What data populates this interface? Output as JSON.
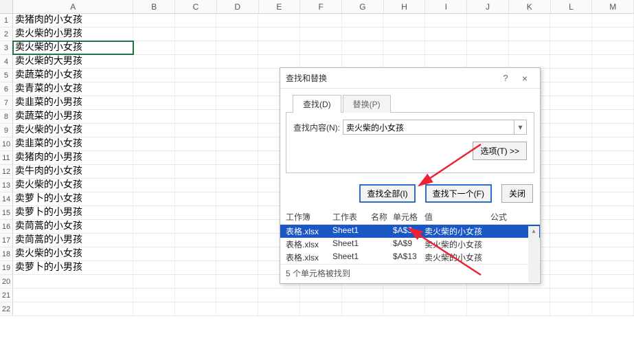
{
  "columns": [
    "A",
    "B",
    "C",
    "D",
    "E",
    "F",
    "G",
    "H",
    "I",
    "J",
    "K",
    "L",
    "M"
  ],
  "rows": [
    "卖猪肉的小女孩",
    "卖火柴的小男孩",
    "卖火柴的小女孩",
    "卖火柴的大男孩",
    "卖蔬菜的小女孩",
    "卖青菜的小女孩",
    "卖韭菜的小男孩",
    "卖蔬菜的小男孩",
    "卖火柴的小女孩",
    "卖韭菜的小女孩",
    "卖猪肉的小男孩",
    "卖牛肉的小女孩",
    "卖火柴的小女孩",
    "卖萝卜的小女孩",
    "卖萝卜的小男孩",
    "卖茼蒿的小女孩",
    "卖茼蒿的小男孩",
    "卖火柴的小女孩",
    "卖萝卜的小男孩",
    "",
    "",
    ""
  ],
  "selected_row_index": 2,
  "dialog": {
    "title": "查找和替换",
    "help": "?",
    "close": "×",
    "tab_find": "查找(D)",
    "tab_replace": "替换(P)",
    "label_content": "查找内容(N):",
    "input_value": "卖火柴的小女孩",
    "options_btn": "选项(T) >>",
    "find_all": "查找全部(I)",
    "find_next": "查找下一个(F)",
    "close_btn": "关闭",
    "heads": {
      "workbook": "工作簿",
      "sheet": "工作表",
      "name": "名称",
      "cell": "单元格",
      "value": "值",
      "formula": "公式"
    },
    "results": [
      {
        "workbook": "表格.xlsx",
        "sheet": "Sheet1",
        "name": "",
        "cell": "$A$3",
        "value": "卖火柴的小女孩",
        "selected": true
      },
      {
        "workbook": "表格.xlsx",
        "sheet": "Sheet1",
        "name": "",
        "cell": "$A$9",
        "value": "卖火柴的小女孩",
        "selected": false
      },
      {
        "workbook": "表格.xlsx",
        "sheet": "Sheet1",
        "name": "",
        "cell": "$A$13",
        "value": "卖火柴的小女孩",
        "selected": false
      }
    ],
    "status": "5 个单元格被找到"
  }
}
